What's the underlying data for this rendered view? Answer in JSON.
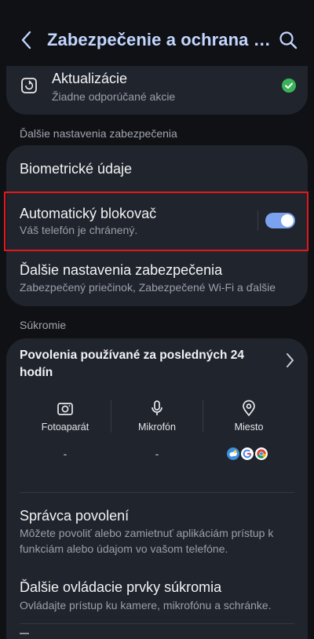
{
  "header": {
    "title": "Zabezpečenie a ochrana o...",
    "back_icon": "chevron-left-icon",
    "search_icon": "search-icon"
  },
  "updates": {
    "title": "Aktualizácie",
    "subtitle": "Žiadne odporúčané akcie",
    "status_color": "#3ab25a"
  },
  "security_section": {
    "label": "Ďalšie nastavenia zabezpečenia",
    "items": [
      {
        "title": "Biometrické údaje"
      },
      {
        "title": "Automatický blokovač",
        "subtitle": "Váš telefón je chránený.",
        "toggle_on": true
      },
      {
        "title": "Ďalšie nastavenia zabezpečenia",
        "subtitle": "Zabezpečený priečinok, Zabezpečené Wi-Fi a ďalšie"
      }
    ]
  },
  "privacy_section": {
    "label": "Súkromie",
    "permissions_title": "Povolenia používané za posledných 24 hodín",
    "columns": [
      {
        "label": "Fotoaparát",
        "icon": "camera-icon",
        "value": "-"
      },
      {
        "label": "Mikrofón",
        "icon": "microphone-icon",
        "value": "-"
      },
      {
        "label": "Miesto",
        "icon": "location-pin-icon",
        "apps": [
          "weather-app-icon",
          "google-app-icon",
          "chrome-app-icon"
        ]
      }
    ],
    "items": [
      {
        "title": "Správca povolení",
        "subtitle": "Môžete povoliť alebo zamietnuť aplikáciám prístup k funkciám alebo údajom vo vašom telefóne."
      },
      {
        "title": "Ďalšie ovládacie prvky súkromia",
        "subtitle": "Ovládajte prístup ku kamere, mikrofónu a schránke."
      }
    ]
  },
  "colors": {
    "accent": "#c3d6ff",
    "toggle": "#7ba2ef",
    "highlight": "#e1191f"
  }
}
